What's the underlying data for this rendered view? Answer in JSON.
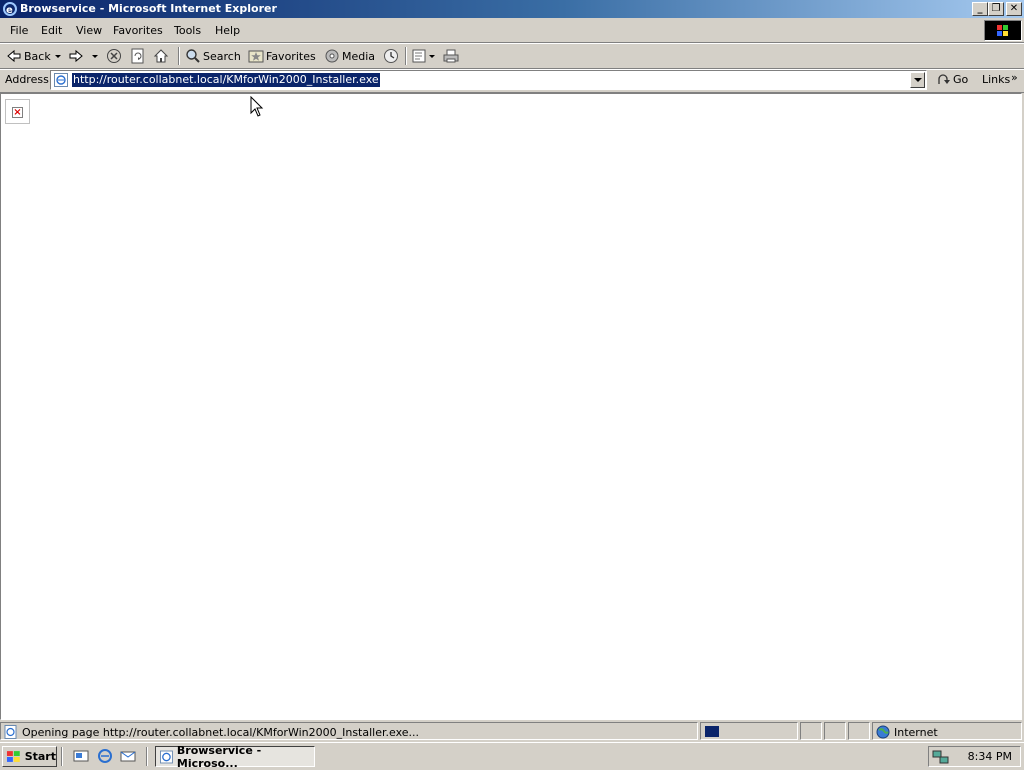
{
  "window": {
    "title": "Browservice - Microsoft Internet Explorer",
    "buttons": {
      "minimize": "_",
      "restore": "❐",
      "close": "✕"
    }
  },
  "menu": [
    "File",
    "Edit",
    "View",
    "Favorites",
    "Tools",
    "Help"
  ],
  "toolbar": {
    "back": "Back",
    "search": "Search",
    "favorites": "Favorites",
    "media": "Media"
  },
  "address": {
    "label": "Address",
    "url": "http://router.collabnet.local/KMforWin2000_Installer.exe",
    "go": "Go",
    "links": "Links",
    "links_chevron": "»"
  },
  "status": {
    "text": "Opening page http://router.collabnet.local/KMforWin2000_Installer.exe...",
    "zone": "Internet"
  },
  "taskbar": {
    "start": "Start",
    "task": "Browservice - Microso...",
    "clock": "8:34 PM"
  }
}
